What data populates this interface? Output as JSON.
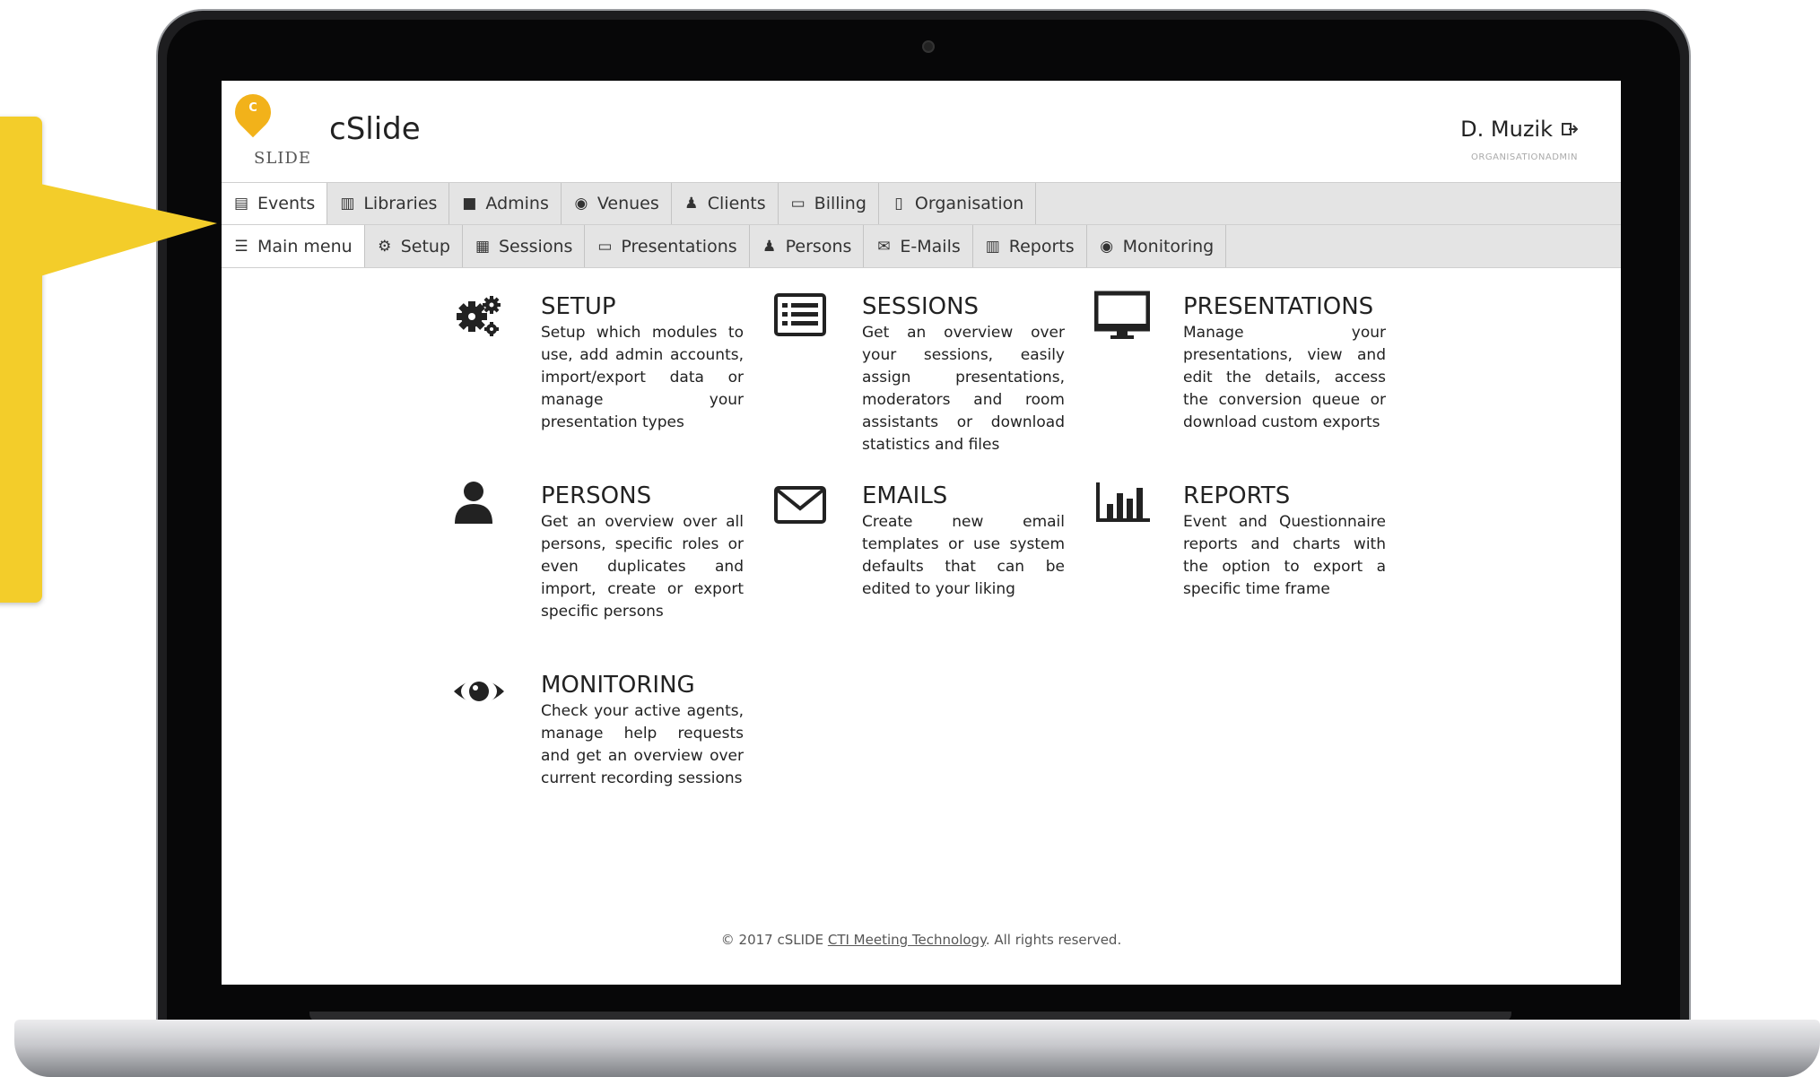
{
  "app": {
    "logo_text": "SLIDE",
    "logo_letter": "C",
    "title": "cSlide"
  },
  "user": {
    "name": "D. Muzik",
    "role": "ORGANISATIONADMIN"
  },
  "nav_primary": [
    {
      "label": "Events",
      "icon": "calendar-icon",
      "active": true
    },
    {
      "label": "Libraries",
      "icon": "book-icon"
    },
    {
      "label": "Admins",
      "icon": "lock-icon"
    },
    {
      "label": "Venues",
      "icon": "map-marker-icon"
    },
    {
      "label": "Clients",
      "icon": "user-tie-icon"
    },
    {
      "label": "Billing",
      "icon": "credit-card-icon"
    },
    {
      "label": "Organisation",
      "icon": "building-icon"
    }
  ],
  "nav_secondary": [
    {
      "label": "Main menu",
      "icon": "menu-icon",
      "active": true
    },
    {
      "label": "Setup",
      "icon": "cogs-icon"
    },
    {
      "label": "Sessions",
      "icon": "list-icon"
    },
    {
      "label": "Presentations",
      "icon": "monitor-icon"
    },
    {
      "label": "Persons",
      "icon": "user-icon"
    },
    {
      "label": "E-Mails",
      "icon": "envelope-icon"
    },
    {
      "label": "Reports",
      "icon": "bar-chart-icon"
    },
    {
      "label": "Monitoring",
      "icon": "eye-icon"
    }
  ],
  "cards": {
    "setup": {
      "title": "SETUP",
      "description": "Setup which modules to use, add admin accounts, import/export data or manage your presentation types",
      "icon": "cogs-icon"
    },
    "sessions": {
      "title": "SESSIONS",
      "description": "Get an overview over your sessions, easily assign presentations, moderators and room assistants or download statistics and files",
      "icon": "list-icon"
    },
    "presentations": {
      "title": "PRESENTATIONS",
      "description": "Manage your presentations, view and edit the details, access the conversion queue or download custom exports",
      "icon": "monitor-icon"
    },
    "persons": {
      "title": "PERSONS",
      "description": "Get an overview over all persons, specific roles or even duplicates and import, create or export specific persons",
      "icon": "user-icon"
    },
    "emails": {
      "title": "EMAILS",
      "description": "Create new email templates or use system defaults that can be edited to your liking",
      "icon": "envelope-icon"
    },
    "reports": {
      "title": "REPORTS",
      "description": "Event and Questionnaire reports and charts with the option to export a specific time frame",
      "icon": "bar-chart-icon"
    },
    "monitoring": {
      "title": "MONITORING",
      "description": "Check your active agents, manage help requests and get an overview over current recording sessions",
      "icon": "eye-icon"
    }
  },
  "footer": {
    "prefix": "© 2017 cSLIDE",
    "link": "CTI Meeting Technology",
    "suffix": ". All rights reserved."
  },
  "colors": {
    "callout": "#f3cd2a",
    "logo": "#f2b21a",
    "nav_bg": "#e4e4e4"
  }
}
